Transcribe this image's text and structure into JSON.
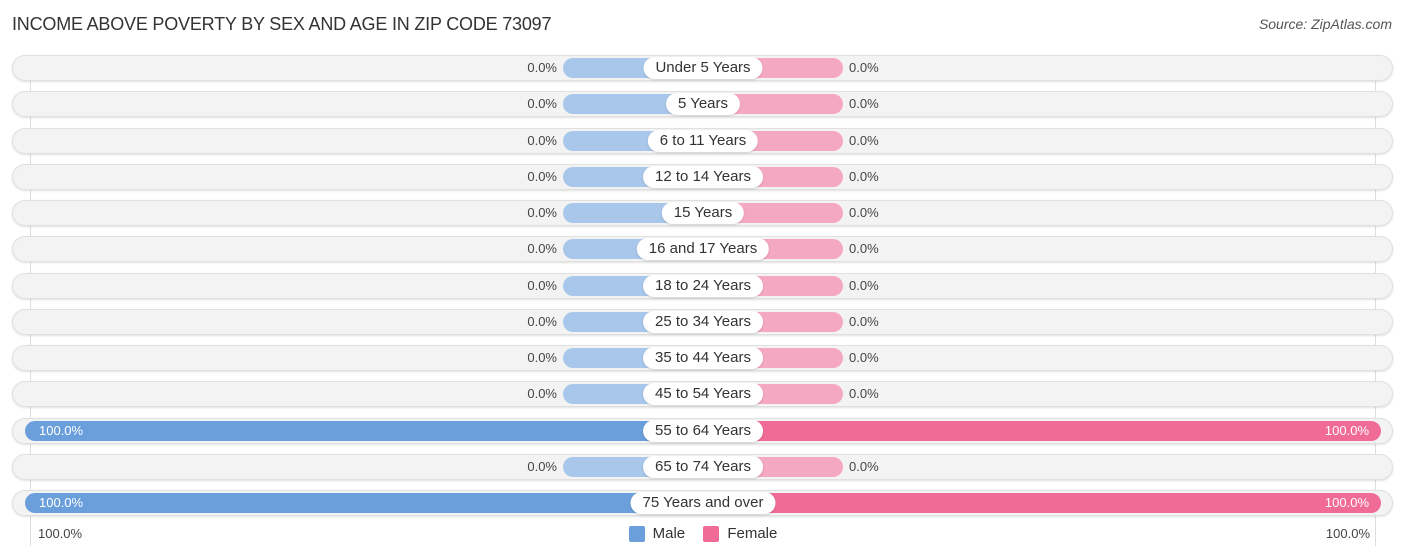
{
  "title": "INCOME ABOVE POVERTY BY SEX AND AGE IN ZIP CODE 73097",
  "source": "Source: ZipAtlas.com",
  "colors": {
    "male": "#6a9fdb",
    "female": "#f06b96",
    "male_zero": "#a9c7ea",
    "female_zero": "#f5a8c1"
  },
  "axis": {
    "left_label": "100.0%",
    "right_label": "100.0%"
  },
  "legend": [
    {
      "label": "Male",
      "color": "#6a9fdb"
    },
    {
      "label": "Female",
      "color": "#f06b96"
    }
  ],
  "chart_data": {
    "type": "bar",
    "title": "INCOME ABOVE POVERTY BY SEX AND AGE IN ZIP CODE 73097",
    "orientation": "horizontal-diverging",
    "xlim": [
      -100,
      100
    ],
    "categories": [
      "Under 5 Years",
      "5 Years",
      "6 to 11 Years",
      "12 to 14 Years",
      "15 Years",
      "16 and 17 Years",
      "18 to 24 Years",
      "25 to 34 Years",
      "35 to 44 Years",
      "45 to 54 Years",
      "55 to 64 Years",
      "65 to 74 Years",
      "75 Years and over"
    ],
    "series": [
      {
        "name": "Male",
        "values": [
          0,
          0,
          0,
          0,
          0,
          0,
          0,
          0,
          0,
          0,
          100,
          0,
          100
        ],
        "labels": [
          "0.0%",
          "0.0%",
          "0.0%",
          "0.0%",
          "0.0%",
          "0.0%",
          "0.0%",
          "0.0%",
          "0.0%",
          "0.0%",
          "100.0%",
          "0.0%",
          "100.0%"
        ]
      },
      {
        "name": "Female",
        "values": [
          0,
          0,
          0,
          0,
          0,
          0,
          0,
          0,
          0,
          0,
          100,
          0,
          100
        ],
        "labels": [
          "0.0%",
          "0.0%",
          "0.0%",
          "0.0%",
          "0.0%",
          "0.0%",
          "0.0%",
          "0.0%",
          "0.0%",
          "0.0%",
          "100.0%",
          "0.0%",
          "100.0%"
        ]
      }
    ],
    "legend_position": "bottom-center"
  }
}
